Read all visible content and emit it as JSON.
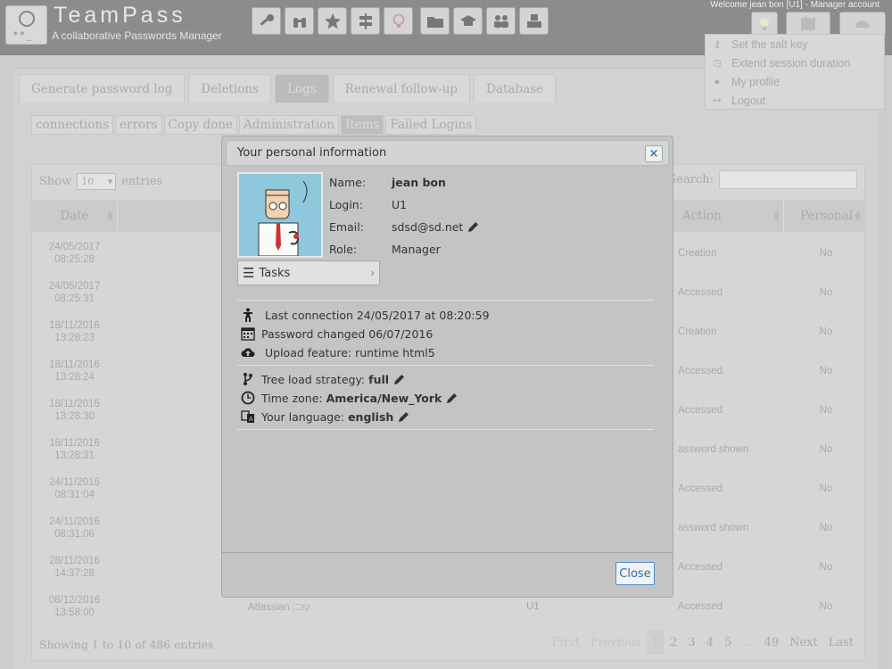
{
  "header": {
    "app_title": "TeamPass",
    "app_subtitle": "A collaborative Passwords Manager",
    "welcome": "Welcome jean bon [U1] - Manager account"
  },
  "user_menu": {
    "items": [
      {
        "label": "Set the salt key",
        "icon": "key-icon"
      },
      {
        "label": "Extend session duration",
        "icon": "clock-icon"
      },
      {
        "label": "My profile",
        "icon": "user-icon"
      },
      {
        "label": "Logout",
        "icon": "logout-icon"
      }
    ]
  },
  "tabs": [
    "Generate password log",
    "Deletions",
    "Logs",
    "Renewal follow-up",
    "Database"
  ],
  "active_tab": "Logs",
  "subtabs": [
    "connections",
    "errors",
    "Copy done",
    "Administration",
    "Items",
    "Failed Logins"
  ],
  "active_subtab": "Items",
  "table": {
    "show_label": "Show",
    "entries_value": "10",
    "entries_label": "entries",
    "search_label": "Search:",
    "columns": {
      "date": "Date",
      "action": "Action",
      "personal": "Personal"
    },
    "rows": [
      {
        "date": "24/05/2017",
        "time": "08:25:28",
        "item": "",
        "user": "",
        "action": "Creation",
        "personal": "No"
      },
      {
        "date": "24/05/2017",
        "time": "08:25:31",
        "item": "",
        "user": "",
        "action": "Accessed",
        "personal": "No"
      },
      {
        "date": "18/11/2016",
        "time": "13:28:23",
        "item": "",
        "user": "",
        "action": "Creation",
        "personal": "No"
      },
      {
        "date": "18/11/2016",
        "time": "13:28:24",
        "item": "",
        "user": "",
        "action": "Accessed",
        "personal": "No"
      },
      {
        "date": "18/11/2016",
        "time": "13:28:30",
        "item": "",
        "user": "",
        "action": "Accessed",
        "personal": "No"
      },
      {
        "date": "18/11/2016",
        "time": "13:28:31",
        "item": "",
        "user": "",
        "action": "assword shown",
        "personal": "No"
      },
      {
        "date": "24/11/2016",
        "time": "08:31:04",
        "item": "",
        "user": "",
        "action": "Accessed",
        "personal": "No"
      },
      {
        "date": "24/11/2016",
        "time": "08:31:06",
        "item": "",
        "user": "",
        "action": "assword shown",
        "personal": "No"
      },
      {
        "date": "28/11/2016",
        "time": "14:37:28",
        "item": "",
        "user": "",
        "action": "Accessed",
        "personal": "No"
      },
      {
        "date": "08/12/2016",
        "time": "13:58:00",
        "item": "Atlassian",
        "item_folder": "F2",
        "user": "U1",
        "action": "Accessed",
        "personal": "No"
      }
    ],
    "showing": "Showing 1 to 10 of 486 entries",
    "pager": {
      "first": "First",
      "previous": "Previous",
      "pages": [
        "1",
        "2",
        "3",
        "4",
        "5",
        "...",
        "49"
      ],
      "next": "Next",
      "last": "Last"
    }
  },
  "dialog": {
    "title": "Your personal information",
    "close_x": "×",
    "fields": [
      {
        "label": "Name:",
        "value": "jean bon",
        "bold": true,
        "editable": false
      },
      {
        "label": "Login:",
        "value": "U1",
        "bold": false,
        "editable": false
      },
      {
        "label": "Email:",
        "value": "sdsd@sd.net",
        "bold": false,
        "editable": true
      },
      {
        "label": "Role:",
        "value": "Manager",
        "bold": false,
        "editable": false
      }
    ],
    "tasks_label": "Tasks",
    "last_connection": "Last connection 24/05/2017 at 08:20:59",
    "password_changed": "Password changed 06/07/2016",
    "upload_feature": "Upload feature: runtime html5",
    "tree_load_label": "Tree load strategy:",
    "tree_load_value": "full",
    "timezone_label": "Time zone:",
    "timezone_value": "America/New_York",
    "language_label": "Your language:",
    "language_value": "english",
    "close_button": "Close"
  }
}
